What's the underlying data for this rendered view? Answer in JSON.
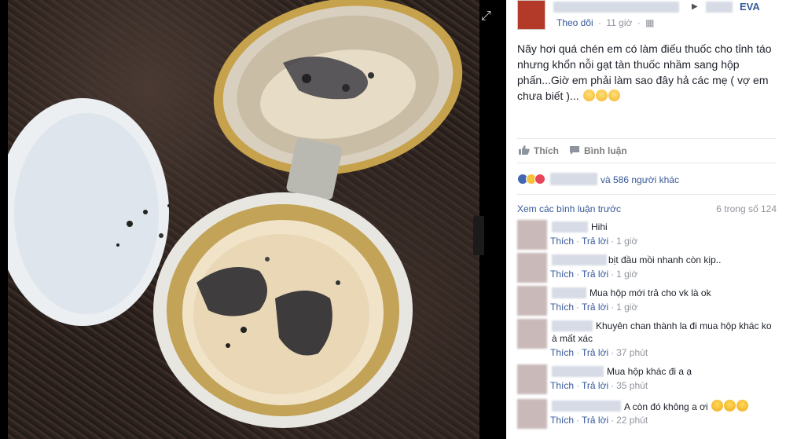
{
  "post": {
    "page_name": "EVA",
    "follow_label": "Theo dõi",
    "time": "11 giờ",
    "audience_icon": "globe-icon",
    "text_main": "Nãy hơi quá chén em có làm điếu thuốc cho tỉnh táo nhưng khổn nỗi gạt tàn thuốc nhầm sang hộp phấn...Giờ em phải làm sao đây hả các mẹ ( vợ em chưa biết )..."
  },
  "actions": {
    "like_label": "Thích",
    "comment_label": "Bình luận"
  },
  "reactions": {
    "others_text": "và 586 người khác"
  },
  "comments_header": {
    "view_previous": "Xem các bình luận trước",
    "count": "6 trong số 124"
  },
  "comments": [
    {
      "text": "Hihi",
      "like": "Thích",
      "reply": "Trả lời",
      "time": "1 giờ"
    },
    {
      "text": "bịt đầu mồi nhanh còn kịp..",
      "like": "Thích",
      "reply": "Trả lời",
      "time": "1 giờ"
    },
    {
      "text": "Mua hộp mới trả cho vk là ok",
      "like": "Thích",
      "reply": "Trả lời",
      "time": "1 giờ"
    },
    {
      "text": "Khuyên chan thành la đi mua hộp khác ko",
      "text2": "à mất xác",
      "like": "Thích",
      "reply": "Trả lời",
      "time": "37 phút"
    },
    {
      "text": "Mua hộp khác đi a ạ",
      "like": "Thích",
      "reply": "Trả lời",
      "time": "35 phút"
    },
    {
      "text": "A còn đó không a ơi",
      "like": "Thích",
      "reply": "Trả lời",
      "time": "22 phút"
    }
  ],
  "colors": {
    "link": "#365899",
    "muted": "#90949c"
  }
}
